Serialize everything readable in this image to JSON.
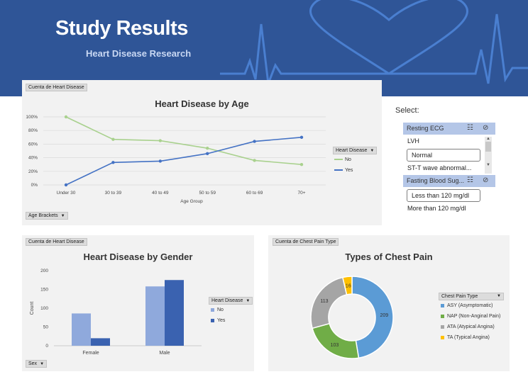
{
  "header": {
    "title": "Study Results",
    "subtitle": "Heart Disease Research"
  },
  "age_panel": {
    "tag": "Cuenta de Heart Disease",
    "filter_button": "Age Brackets",
    "legend_title": "Heart Disease",
    "legend_items": [
      "No",
      "Yes"
    ]
  },
  "gender_panel": {
    "tag": "Cuenta de Heart Disease",
    "filter_button": "Sex",
    "legend_title": "Heart Disease",
    "legend_items": [
      "No",
      "Yes"
    ]
  },
  "chest_panel": {
    "tag": "Cuenta de Chest Pain Type",
    "legend_title": "Chest Pain Type"
  },
  "select_label": "Select:",
  "slicers": {
    "ecg": {
      "title": "Resting ECG",
      "items": [
        "LVH",
        "Normal",
        "ST-T wave abnormal..."
      ],
      "selected": "Normal"
    },
    "fbs": {
      "title": "Fasting Blood Sug...",
      "items": [
        "Less than 120 mg/dl",
        "More than 120 mg/dl"
      ],
      "selected": "Less than 120 mg/dl"
    }
  },
  "colors": {
    "banner": "#2f5597",
    "no": "#8fb8e6",
    "yes": "#4472c4",
    "green": "#a9d18e",
    "asy": "#5b9bd5",
    "nap": "#70ad47",
    "ata": "#a5a5a5",
    "ta": "#ffc000"
  },
  "chart_data": [
    {
      "type": "line",
      "title": "Heart Disease by Age",
      "xlabel": "Age Group",
      "ylabel": "",
      "categories": [
        "Under 30",
        "30 to 39",
        "40 to 49",
        "50 to 59",
        "60 to 69",
        "70+"
      ],
      "ylim": [
        0,
        100
      ],
      "yticks": [
        "0%",
        "20%",
        "40%",
        "60%",
        "80%",
        "100%"
      ],
      "series": [
        {
          "name": "No",
          "values": [
            100,
            67,
            65,
            54,
            36,
            30
          ]
        },
        {
          "name": "Yes",
          "values": [
            0,
            33,
            35,
            46,
            64,
            70
          ]
        }
      ],
      "grid": true,
      "legend": "right"
    },
    {
      "type": "bar",
      "title": "Heart Disease by Gender",
      "xlabel": "",
      "ylabel": "Count",
      "categories": [
        "Female",
        "Male"
      ],
      "ylim": [
        0,
        200
      ],
      "yticks": [
        "0",
        "50",
        "100",
        "150",
        "200"
      ],
      "series": [
        {
          "name": "No",
          "values": [
            86,
            158
          ]
        },
        {
          "name": "Yes",
          "values": [
            20,
            175
          ]
        }
      ],
      "legend": "right"
    },
    {
      "type": "pie",
      "title": "Types of Chest Pain",
      "labels": [
        "ASY (Asymptomatic)",
        "NAP (Non-Anginal Pain)",
        "ATA (Atypical Angina)",
        "TA (Typical Angina)"
      ],
      "values": [
        209,
        103,
        113,
        16
      ],
      "donut": true,
      "legend": "right"
    }
  ]
}
